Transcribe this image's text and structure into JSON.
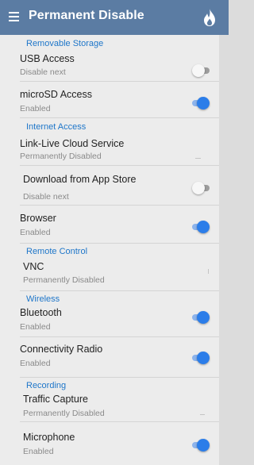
{
  "appbar": {
    "title": "Permanent Disable",
    "menu_icon": "hamburger-icon",
    "action_icon": "flame-icon",
    "background": "#5b7ca3"
  },
  "sections": {
    "removable_storage": "Removable Storage",
    "internet_access": "Internet Access",
    "remote_control": "Remote Control",
    "wireless": "Wireless",
    "recording": "Recording"
  },
  "items": {
    "usb_access": {
      "label": "USB Access",
      "status": "Disable next",
      "toggle": "off"
    },
    "microsd_access": {
      "label": "microSD Access",
      "status": "Enabled",
      "toggle": "on"
    },
    "link_live": {
      "label": "Link-Live Cloud Service",
      "status": "Permanently Disabled"
    },
    "download_app_store": {
      "label": "Download from App Store",
      "status": "Disable next",
      "toggle": "off"
    },
    "browser": {
      "label": "Browser",
      "status": "Enabled",
      "toggle": "on"
    },
    "vnc": {
      "label": "VNC",
      "status": "Permanently Disabled"
    },
    "bluetooth": {
      "label": "Bluetooth",
      "status": "Enabled",
      "toggle": "on"
    },
    "connectivity_radio": {
      "label": "Connectivity Radio",
      "status": "Enabled",
      "toggle": "on"
    },
    "traffic_capture": {
      "label": "Traffic Capture",
      "status": "Permanently Disabled"
    },
    "microphone": {
      "label": "Microphone",
      "status": "Enabled",
      "toggle": "on"
    }
  },
  "colors": {
    "accent": "#2b7de9",
    "section_header": "#1e76c9"
  }
}
